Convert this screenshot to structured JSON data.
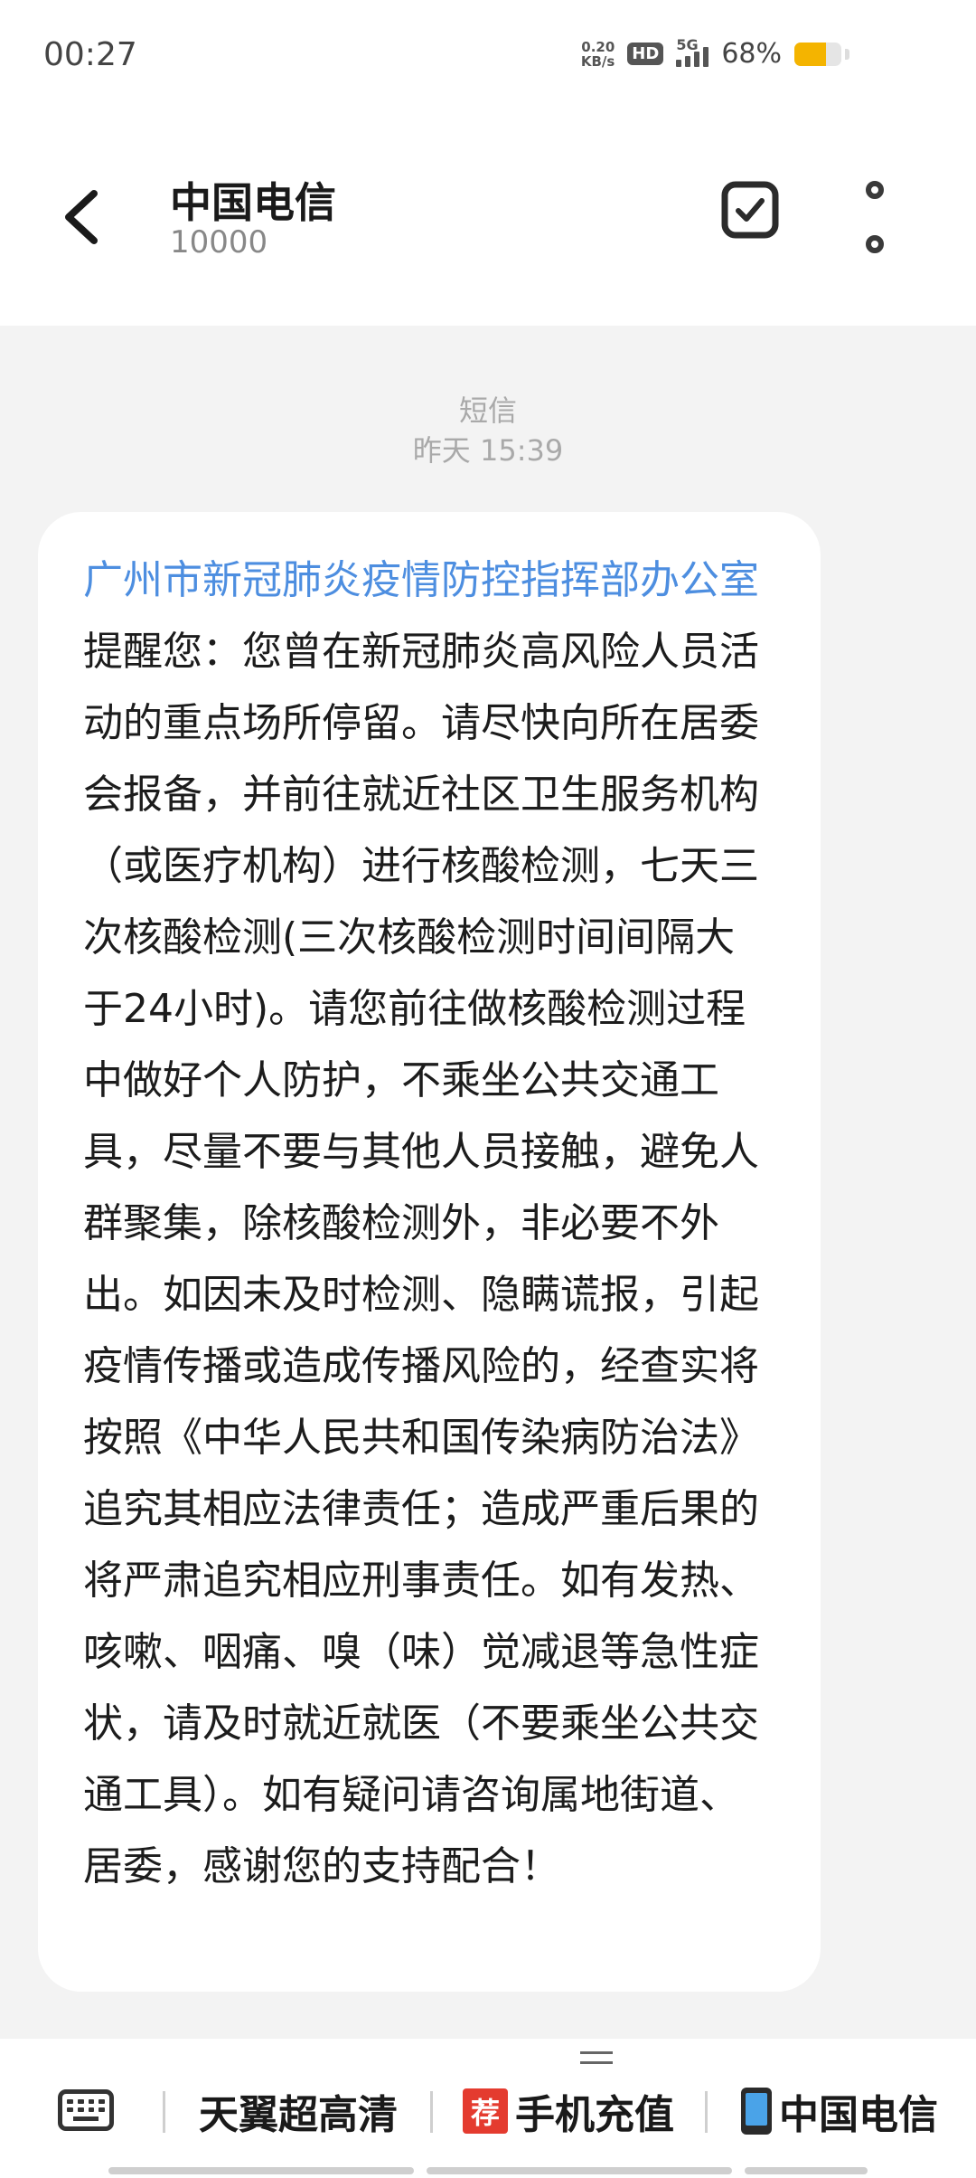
{
  "status_bar": {
    "time": "00:27",
    "net_speed_value": "0.20",
    "net_speed_unit": "KB/s",
    "hd_label": "HD",
    "network_label": "5G",
    "battery_percent": "68%",
    "battery_level": 0.68,
    "battery_color": "#f4b400"
  },
  "header": {
    "contact_name": "中国电信",
    "contact_number": "10000",
    "back_icon": "chevron-left-icon",
    "select_icon": "checkbox-icon",
    "more_icon": "more-vertical-icon"
  },
  "message": {
    "channel": "短信",
    "timestamp": "昨天 15:39",
    "sender_link": "广州市新冠肺炎疫情防控指挥部办公室",
    "body": "提醒您：您曾在新冠肺炎高风险人员活动的重点场所停留。请尽快向所在居委会报备，并前往就近社区卫生服务机构（或医疗机构）进行核酸检测，七天三次核酸检测(三次核酸检测时间间隔大于24小时)。请您前往做核酸检测过程中做好个人防护，不乘坐公共交通工具，尽量不要与其他人员接触，避免人群聚集，除核酸检测外，非必要不外出。如因未及时检测、隐瞒谎报，引起疫情传播或造成传播风险的，经查实将按照《中华人民共和国传染病防治法》追究其相应法律责任；造成严重后果的将严肃追究相应刑事责任。如有发热、咳嗽、咽痛、嗅（味）觉减退等急性症状，请及时就近就医（不要乘坐公共交通工具）。如有疑问请咨询属地街道、居委，感谢您的支持配合！",
    "link_color": "#4d8ee0"
  },
  "bottom_menu": {
    "keyboard_icon": "keyboard-icon",
    "items": [
      {
        "label": "天翼超高清"
      },
      {
        "badge": "荐",
        "label": "手机充值"
      },
      {
        "label": "中国电信",
        "icon": "mobile-phone-icon"
      }
    ]
  }
}
